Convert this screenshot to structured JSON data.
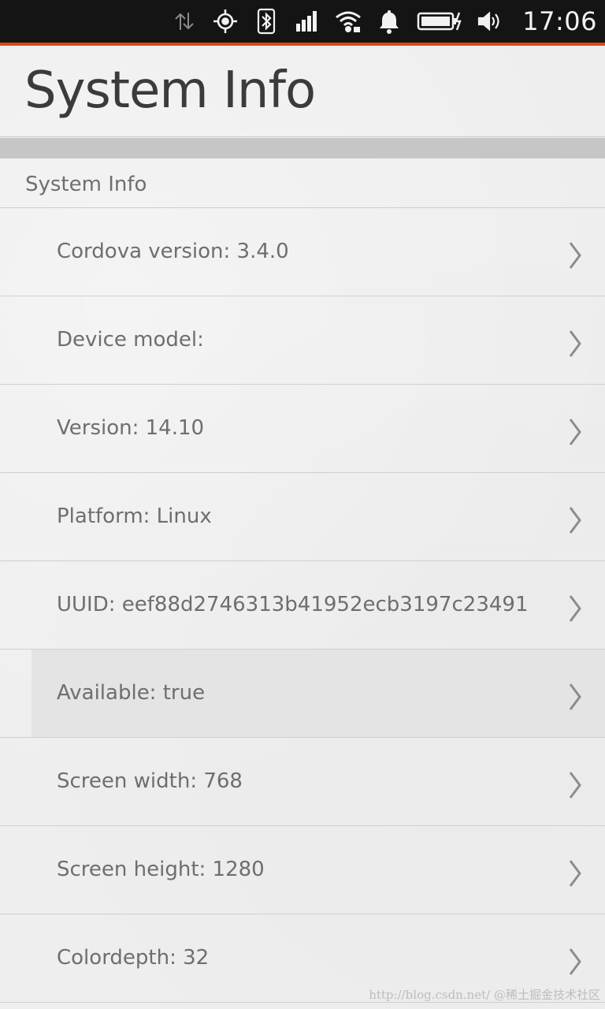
{
  "status_bar": {
    "time": "17:06",
    "icons": [
      "data-transfer-icon",
      "location-icon",
      "bluetooth-icon",
      "signal-icon",
      "wifi-icon",
      "notification-bell-icon",
      "battery-charging-icon",
      "volume-icon"
    ],
    "accent_color": "#dd4814"
  },
  "header": {
    "title": "System Info"
  },
  "section": {
    "label": "System Info"
  },
  "items": [
    {
      "label": "Cordova version: 3.4.0"
    },
    {
      "label": "Device model:"
    },
    {
      "label": "Version: 14.10"
    },
    {
      "label": "Platform: Linux"
    },
    {
      "label": "UUID: eef88d2746313b41952ecb3197c23491"
    },
    {
      "label": "Available: true",
      "highlighted": true
    },
    {
      "label": "Screen width: 768"
    },
    {
      "label": "Screen height: 1280"
    },
    {
      "label": "Colordepth: 32"
    }
  ],
  "watermark": "http://blog.csdn.net/ @稀土掘金技术社区"
}
